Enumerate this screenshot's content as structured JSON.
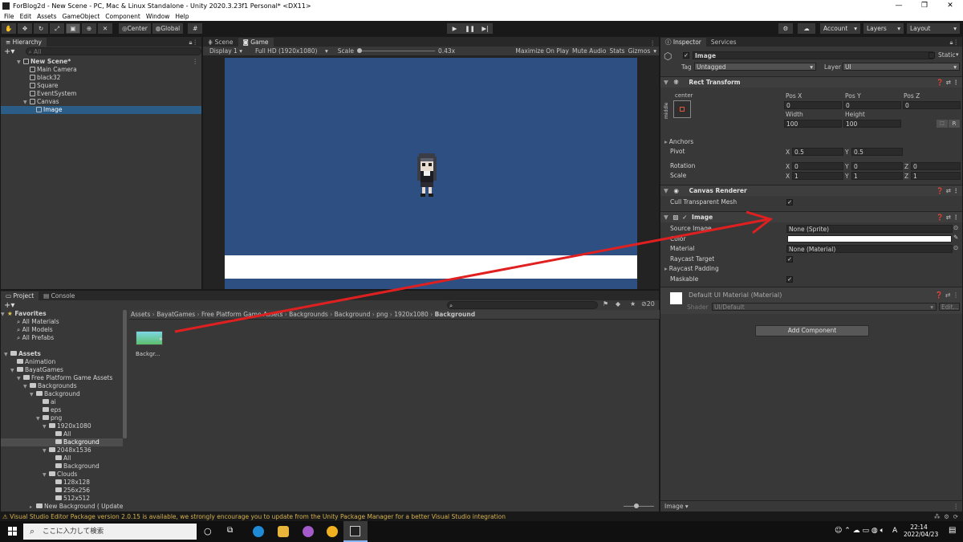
{
  "window": {
    "title": "ForBlog2d - New Scene - PC, Mac & Linux Standalone - Unity 2020.3.23f1 Personal* <DX11>",
    "controls": [
      "—",
      "❐",
      "✕"
    ]
  },
  "menu": [
    "File",
    "Edit",
    "Assets",
    "GameObject",
    "Component",
    "Window",
    "Help"
  ],
  "toolbar": {
    "pivot_label": "Center",
    "space_label": "Global",
    "account_label": "Account",
    "layers_label": "Layers",
    "layout_label": "Layout"
  },
  "hierarchy": {
    "tab_label": "Hierarchy",
    "search_placeholder": "All",
    "items": [
      {
        "label": "New Scene*",
        "indent": 0,
        "selected": false
      },
      {
        "label": "Main Camera",
        "indent": 1,
        "selected": false
      },
      {
        "label": "black32",
        "indent": 1,
        "selected": false
      },
      {
        "label": "Square",
        "indent": 1,
        "selected": false
      },
      {
        "label": "EventSystem",
        "indent": 1,
        "selected": false
      },
      {
        "label": "Canvas",
        "indent": 1,
        "selected": false
      },
      {
        "label": "Image",
        "indent": 2,
        "selected": true
      }
    ]
  },
  "game": {
    "tabs": [
      "Scene",
      "Game"
    ],
    "display": "Display 1",
    "resolution": "Full HD (1920x1080)",
    "scale_label": "Scale",
    "scale_value": "0.43x",
    "options": [
      "Maximize On Play",
      "Mute Audio",
      "Stats",
      "Gizmos"
    ],
    "colors": {
      "background": "#2e4f82",
      "strip": "#ffffff"
    }
  },
  "project": {
    "tabs": [
      "Project",
      "Console"
    ],
    "favorites_label": "Favorites",
    "favorites": [
      "All Materials",
      "All Models",
      "All Prefabs"
    ],
    "tree": [
      {
        "label": "Assets",
        "indent": 0,
        "selected": false
      },
      {
        "label": "Animation",
        "indent": 1,
        "selected": false
      },
      {
        "label": "BayatGames",
        "indent": 1,
        "selected": false
      },
      {
        "label": "Free Platform Game Assets",
        "indent": 2,
        "selected": false
      },
      {
        "label": "Backgrounds",
        "indent": 3,
        "selected": false
      },
      {
        "label": "Background",
        "indent": 4,
        "selected": false
      },
      {
        "label": "ai",
        "indent": 5,
        "selected": false
      },
      {
        "label": "eps",
        "indent": 5,
        "selected": false
      },
      {
        "label": "png",
        "indent": 5,
        "selected": false
      },
      {
        "label": "1920x1080",
        "indent": 6,
        "selected": false
      },
      {
        "label": "All",
        "indent": 7,
        "selected": false
      },
      {
        "label": "Background",
        "indent": 7,
        "selected": true
      },
      {
        "label": "2048x1536",
        "indent": 6,
        "selected": false
      },
      {
        "label": "All",
        "indent": 7,
        "selected": false
      },
      {
        "label": "Background",
        "indent": 7,
        "selected": false
      },
      {
        "label": "Clouds",
        "indent": 6,
        "selected": false
      },
      {
        "label": "128x128",
        "indent": 7,
        "selected": false
      },
      {
        "label": "256x256",
        "indent": 7,
        "selected": false
      },
      {
        "label": "512x512",
        "indent": 7,
        "selected": false
      },
      {
        "label": "New Background ( Update",
        "indent": 4,
        "selected": false
      }
    ],
    "breadcrumb": [
      "Assets",
      "BayatGames",
      "Free Platform Game Assets",
      "Backgrounds",
      "Background",
      "png",
      "1920x1080",
      "Background"
    ],
    "asset_label": "Backgr...",
    "hidden_count": "20"
  },
  "inspector": {
    "tabs": [
      "Inspector",
      "Services"
    ],
    "object_name": "Image",
    "static_label": "Static",
    "tag_label": "Tag",
    "tag_value": "Untagged",
    "layer_label": "Layer",
    "layer_value": "UI",
    "rect_transform": {
      "title": "Rect Transform",
      "anchor_h": "center",
      "anchor_v": "middle",
      "pos_x_label": "Pos X",
      "pos_x": "0",
      "pos_y_label": "Pos Y",
      "pos_y": "0",
      "pos_z_label": "Pos Z",
      "pos_z": "0",
      "width_label": "Width",
      "width": "100",
      "height_label": "Height",
      "height": "100",
      "anchors_label": "Anchors",
      "pivot_label": "Pivot",
      "pivot_x": "0.5",
      "pivot_y": "0.5",
      "rotation_label": "Rotation",
      "rot_x": "0",
      "rot_y": "0",
      "rot_z": "0",
      "scale_label": "Scale",
      "scale_x": "1",
      "scale_y": "1",
      "scale_z": "1",
      "axis_x": "X",
      "axis_y": "Y",
      "axis_z": "Z",
      "r_label": "R"
    },
    "canvas_renderer": {
      "title": "Canvas Renderer",
      "cull_label": "Cull Transparent Mesh"
    },
    "image": {
      "title": "Image",
      "source_label": "Source Image",
      "source_value": "None (Sprite)",
      "color_label": "Color",
      "color_value": "#ffffff",
      "material_label": "Material",
      "material_value": "None (Material)",
      "raycast_target_label": "Raycast Target",
      "raycast_padding_label": "Raycast Padding",
      "maskable_label": "Maskable"
    },
    "material": {
      "name": "Default UI Material (Material)",
      "shader_label": "Shader",
      "shader_value": "UI/Default",
      "edit_label": "Edit..."
    },
    "add_component": "Add Component",
    "footer_label": "Image"
  },
  "status": {
    "message": "Visual Studio Editor Package version 2.0.15 is available, we strongly encourage you to update from the Unity Package Manager for a better Visual Studio integration"
  },
  "taskbar": {
    "search_placeholder": "ここに入力して検索",
    "ime": "A",
    "time": "22:14",
    "date": "2022/04/23"
  },
  "annotation_color": "#e02020"
}
